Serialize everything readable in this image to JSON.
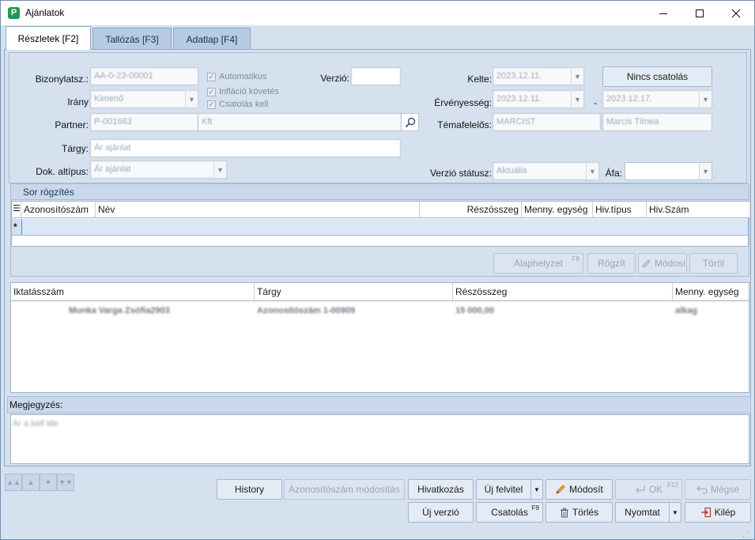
{
  "window": {
    "title": "Ajánlatok",
    "controls": {
      "minimize": "—",
      "maximize": "☐",
      "close": "✕"
    }
  },
  "tabs": [
    {
      "label": "Részletek [F2]",
      "active": true
    },
    {
      "label": "Tallózás [F3]",
      "active": false
    },
    {
      "label": "Adatlap [F4]",
      "active": false
    }
  ],
  "form": {
    "bizonylatsz_label": "Bizonylatsz.:",
    "bizonylatsz_value": "AA-0-23-00001",
    "automatikus_label": "Automatikus",
    "inflacio_label": "Infláció követés",
    "csatolas_kell_label": "Csatolás kell",
    "verzio_label": "Verzió:",
    "verzio_value": "",
    "kelte_label": "Kelte:",
    "kelte_value": "2023.12.11.",
    "nincs_csatolas_label": "Nincs csatolás",
    "irany_label": "Irány",
    "irany_value": "Kimenő",
    "ervenyesseg_label": "Érvényesség:",
    "ervenyesseg_from": "2023.12.11.",
    "ervenyesseg_dash": "-",
    "ervenyesseg_to": "2023.12.17.",
    "partner_label": "Partner:",
    "partner_code": "P-001663",
    "partner_name": "Kft",
    "temafelelos_label": "Témafelelős:",
    "temafelelos_code": "MARCIST",
    "temafelelos_name": "Marcis Tímea",
    "targy_label": "Tárgy:",
    "targy_value": "Ár ajánlat",
    "dok_altipus_label": "Dok. altípus:",
    "dok_altipus_value": "Ár ajánlat",
    "verzio_statusz_label": "Verzió státusz:",
    "verzio_statusz_value": "Aktuális",
    "afa_label": "Áfa:",
    "afa_value": ""
  },
  "sor_rogzites": {
    "title": "Sor rögzítés",
    "columns": [
      "Azonosítószám",
      "Név",
      "Részösszeg",
      "Menny. egység",
      "Hiv.típus",
      "Hiv.Szám"
    ],
    "new_row_marker": "*",
    "buttons": {
      "alaphelyzet": "Alaphelyzet",
      "alaphelyzet_key": "F8",
      "rogzit": "Rögzít",
      "modosit": "Módosí",
      "torol": "Töröl"
    }
  },
  "items_grid": {
    "columns": [
      "Iktatásszám",
      "Tárgy",
      "Részösszeg",
      "Menny. egység"
    ],
    "rows": [
      {
        "iktatasszam": "Munka Varga Zsófia2903",
        "targy": "Azonosítószám 1-00909",
        "reszosszeg": "15 000,00",
        "menny": "alkag"
      }
    ]
  },
  "megjegyzes": {
    "label": "Megjegyzés:",
    "value": "Ár a kell ide"
  },
  "nav_arrows": [
    "▲▲",
    "▲",
    "▼",
    "▼▼"
  ],
  "bottom_buttons": {
    "history": "History",
    "azonositoszam_modositas": "Azonosítószám módosítás",
    "hivatkozas": "Hivatkozás",
    "uj_felvitel": "Új felvitel",
    "modosit": "Módosít",
    "ok": "OK",
    "ok_key": "F12",
    "megse": "Mégse",
    "uj_verzio": "Új verzió",
    "csatolas": "Csatolás",
    "csatolas_key": "F9",
    "torles": "Törlés",
    "nyomtat": "Nyomtat",
    "kilep": "Kilép"
  }
}
